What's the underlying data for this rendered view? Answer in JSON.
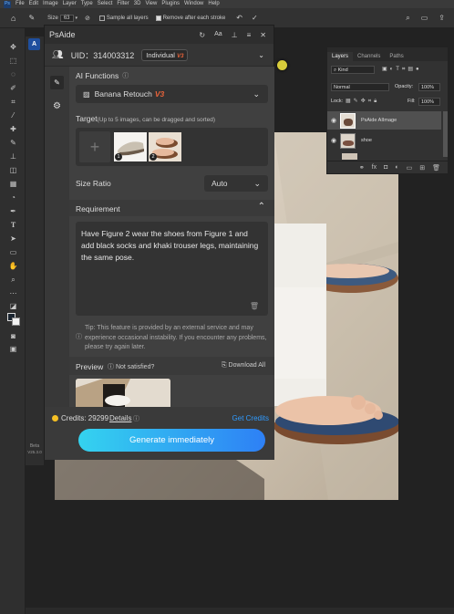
{
  "menubar": {
    "items": [
      "File",
      "Edit",
      "Image",
      "Layer",
      "Type",
      "Select",
      "Filter",
      "3D",
      "View",
      "Plugins",
      "Window",
      "Help"
    ]
  },
  "optbar": {
    "size_label": "Size",
    "size_value": "63",
    "sample_all_layers": "Sample all layers",
    "remove_after_stroke": "Remove after each stroke"
  },
  "layers_panel": {
    "tabs": [
      "Layers",
      "Channels",
      "Paths"
    ],
    "kind": "Kind",
    "blend_mode": "Normal",
    "opacity_label": "Opacity:",
    "opacity_value": "100%",
    "lock_label": "Lock:",
    "fill_label": "Fill:",
    "fill_value": "100%",
    "layers": [
      {
        "name": "PsAide AIImage",
        "selected": true
      },
      {
        "name": "shoe",
        "selected": false
      }
    ]
  },
  "plugin": {
    "title": "PsAide",
    "uid": "UID：314003312",
    "plan": "Individual",
    "plan_badge": "V3",
    "ai_functions_label": "AI Functions",
    "function_name": "Banana Retouch",
    "function_badge": "V3",
    "target_label": "Target",
    "target_hint": "(Up to 5 images, can be dragged and sorted)",
    "target_images": [
      {
        "index": "1"
      },
      {
        "index": "2"
      }
    ],
    "size_ratio_label": "Size Ratio",
    "size_ratio_value": "Auto",
    "requirement_label": "Requirement",
    "requirement_text": "Have Figure 2 wear the shoes from Figure 1 and add black socks and khaki trouser legs, maintaining the same pose.",
    "tip_text": "Tip: This feature is provided by an external service and may experience occasional instability. If you encounter any problems, please try again later.",
    "preview_label": "Preview",
    "not_satisfied": "Not satisfied?",
    "download_all": "Download All",
    "credits_label": "Credits: 29299",
    "details_link": "Details",
    "get_credits": "Get Credits",
    "generate_button": "Generate immediately",
    "version_beta": "Beta",
    "version_number": "V25.3.0"
  },
  "colors": {
    "accent": "#2f9bff",
    "badge": "#e8633a",
    "credit_dot": "#f5c024",
    "generate_from": "#34d3ef",
    "generate_to": "#2e80f5"
  }
}
